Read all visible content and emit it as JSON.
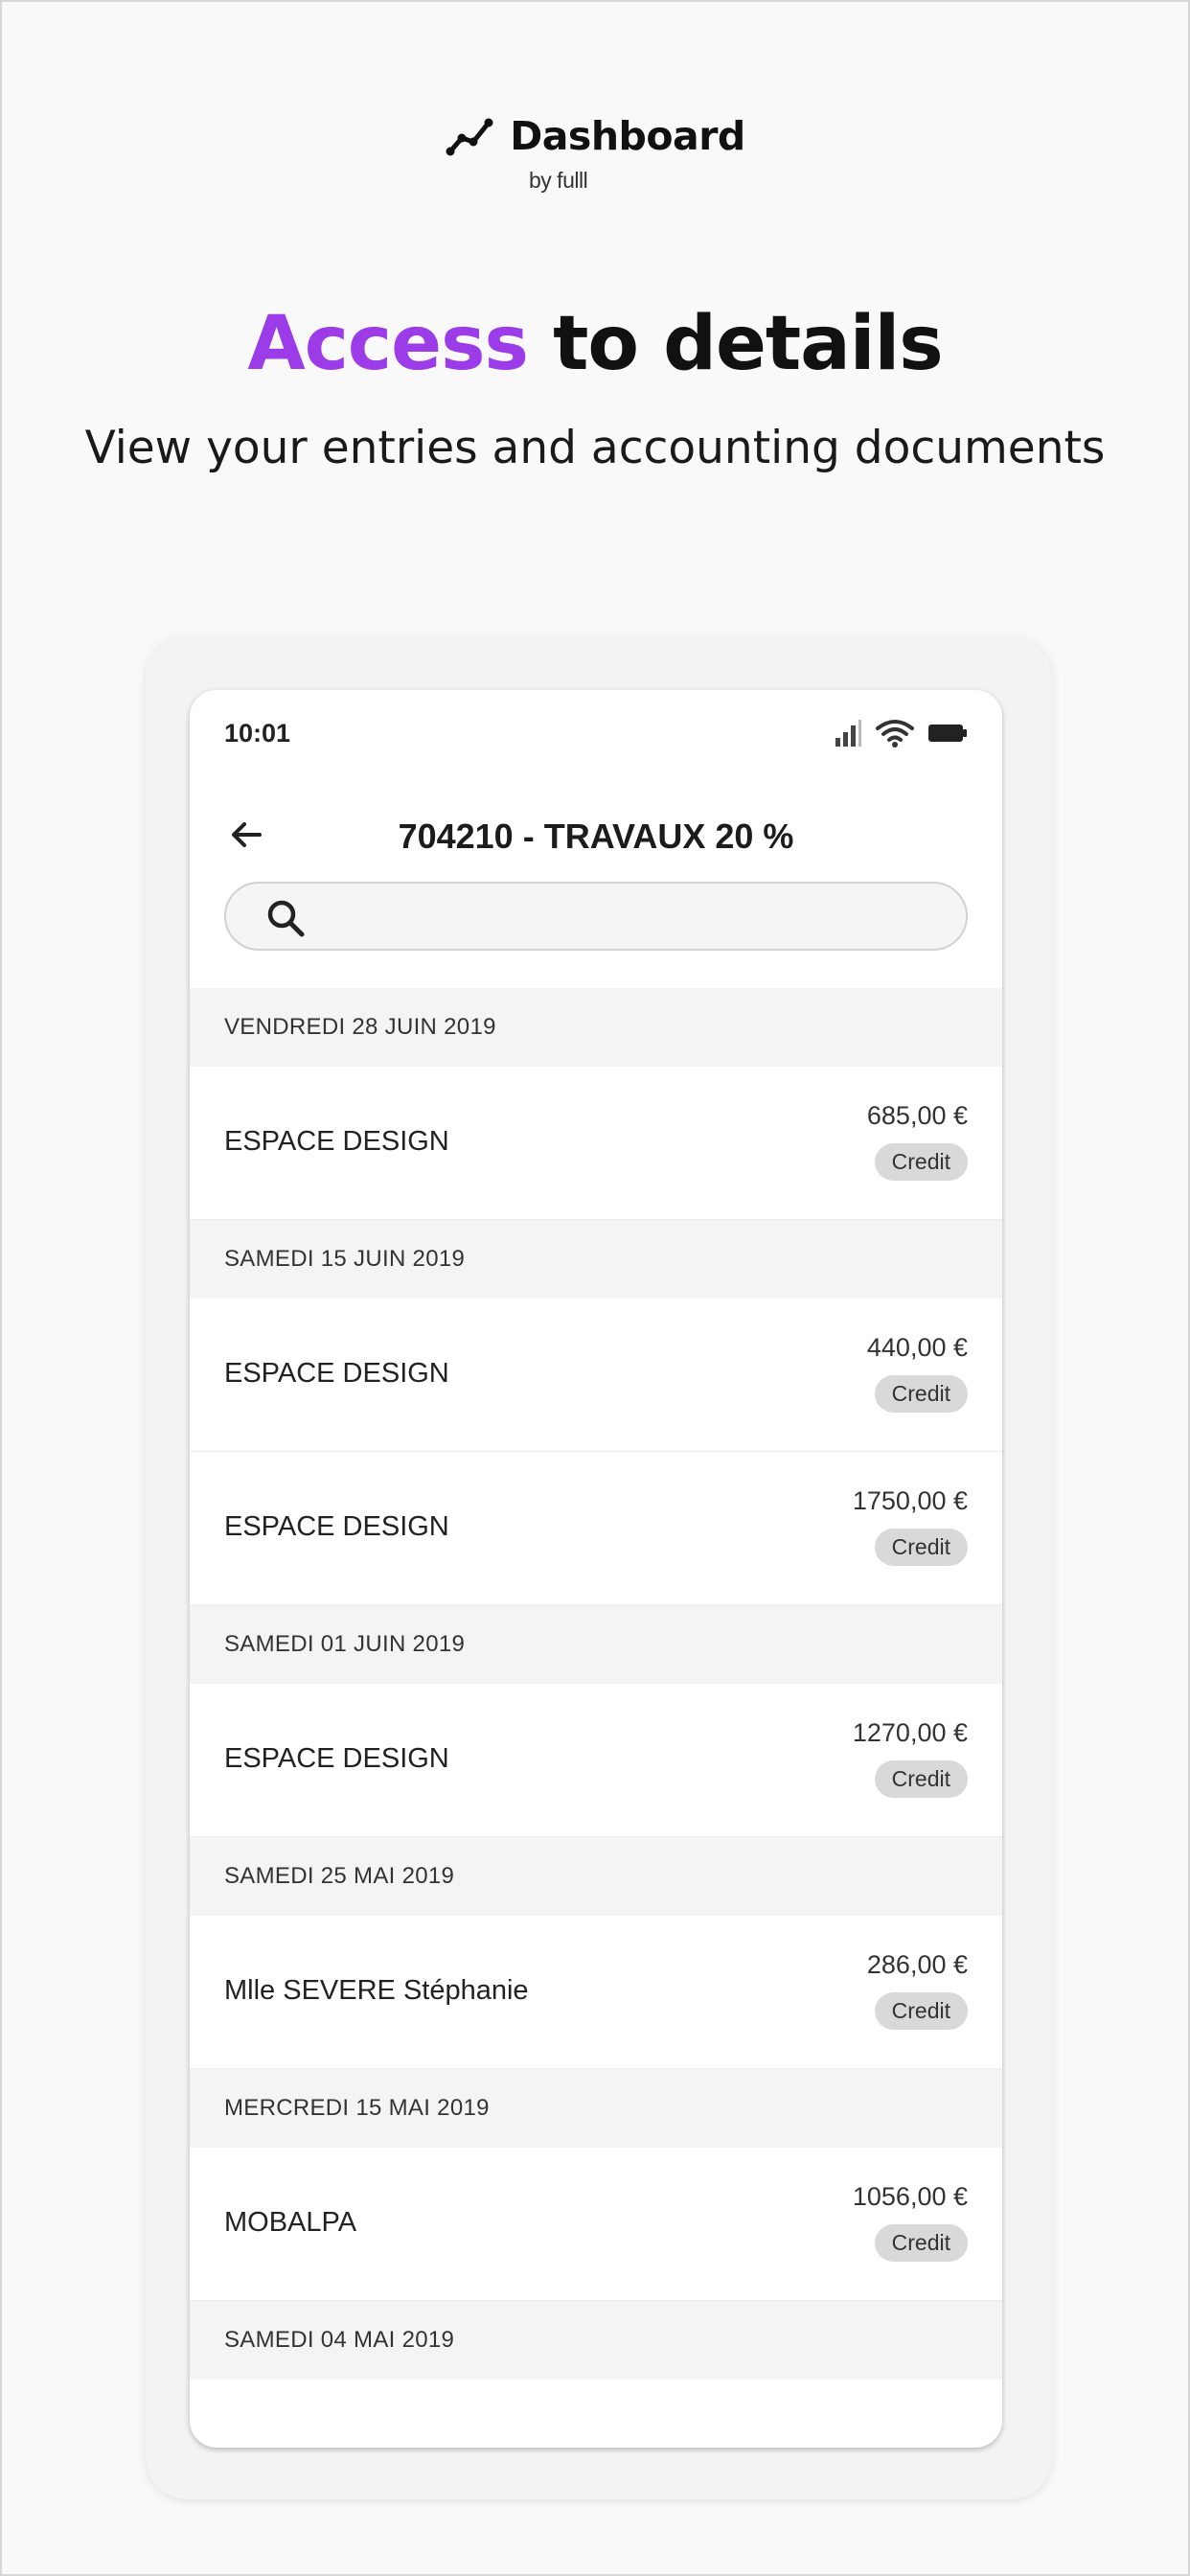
{
  "brand": {
    "title": "Dashboard",
    "subtitle": "by fulll"
  },
  "headline": {
    "accent": "Access",
    "rest": " to details"
  },
  "subline": "View your entries and accounting documents",
  "status_bar": {
    "time": "10:01"
  },
  "app_bar": {
    "title": "704210 - TRAVAUX 20 %"
  },
  "search": {
    "placeholder": "",
    "value": ""
  },
  "sections": [
    {
      "date": "VENDREDI 28 JUIN 2019",
      "entries": [
        {
          "name": "ESPACE DESIGN",
          "amount": "685,00 €",
          "badge": "Credit"
        }
      ]
    },
    {
      "date": "SAMEDI 15 JUIN 2019",
      "entries": [
        {
          "name": "ESPACE DESIGN",
          "amount": "440,00 €",
          "badge": "Credit"
        },
        {
          "name": "ESPACE DESIGN",
          "amount": "1750,00 €",
          "badge": "Credit"
        }
      ]
    },
    {
      "date": "SAMEDI 01 JUIN 2019",
      "entries": [
        {
          "name": "ESPACE DESIGN",
          "amount": "1270,00 €",
          "badge": "Credit"
        }
      ]
    },
    {
      "date": "SAMEDI 25 MAI 2019",
      "entries": [
        {
          "name": "Mlle SEVERE Stéphanie",
          "amount": "286,00 €",
          "badge": "Credit"
        }
      ]
    },
    {
      "date": "MERCREDI 15 MAI 2019",
      "entries": [
        {
          "name": "MOBALPA",
          "amount": "1056,00 €",
          "badge": "Credit"
        }
      ]
    },
    {
      "date": "SAMEDI 04 MAI 2019",
      "entries": []
    }
  ],
  "colors": {
    "accent": "#9b3ce8",
    "badge_bg": "#d9d9d9",
    "section_bg": "#f4f4f4"
  }
}
